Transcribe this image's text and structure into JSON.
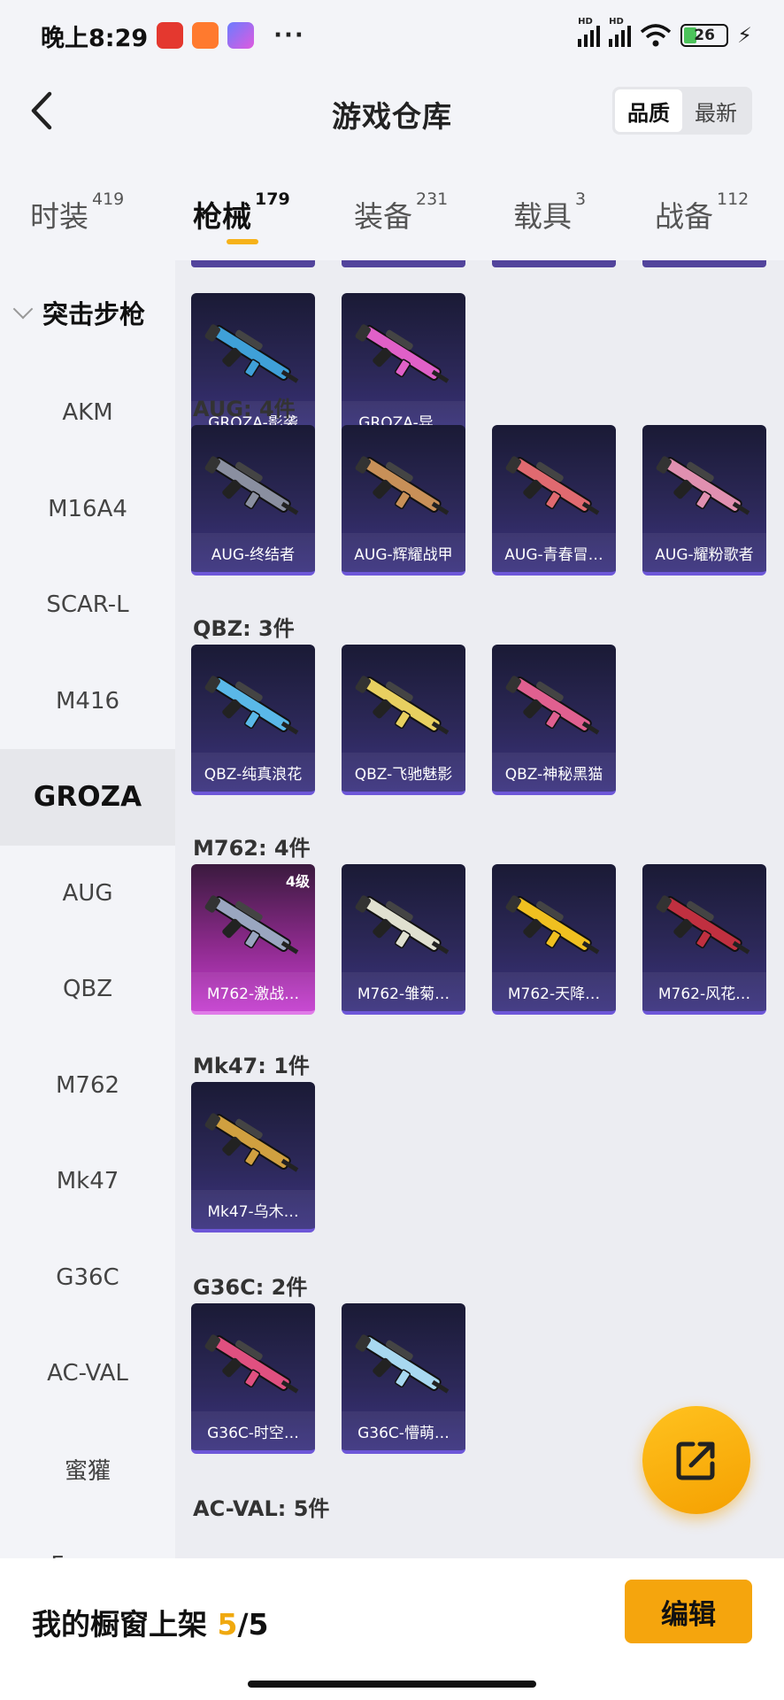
{
  "status_bar": {
    "time": "晚上8:29",
    "battery": "26",
    "more": "···",
    "signal_tag": "HD"
  },
  "header": {
    "title": "游戏仓库",
    "sort_options": [
      "品质",
      "最新"
    ]
  },
  "tabs": [
    {
      "label": "时装",
      "count": "419"
    },
    {
      "label": "枪械",
      "count": "179"
    },
    {
      "label": "装备",
      "count": "231"
    },
    {
      "label": "载具",
      "count": "3"
    },
    {
      "label": "战备",
      "count": "112"
    }
  ],
  "sidebar": {
    "group": "突击步枪",
    "items": [
      "AKM",
      "M16A4",
      "SCAR-L",
      "M416",
      "GROZA",
      "AUG",
      "QBZ",
      "M762",
      "Mk47",
      "G36C",
      "AC-VAL",
      "蜜獾",
      "Famas"
    ],
    "selected": "GROZA"
  },
  "sections": [
    {
      "title": "",
      "items": [
        {
          "name": "GROZA-影袭",
          "color": "#3fa0d8"
        },
        {
          "name": "GROZA-异…",
          "color": "#e060c8"
        }
      ]
    },
    {
      "title": "AUG: 4件",
      "items": [
        {
          "name": "AUG-终结者",
          "color": "#8a8fa0"
        },
        {
          "name": "AUG-辉耀战甲",
          "color": "#c89058"
        },
        {
          "name": "AUG-青春冒…",
          "color": "#e06a70"
        },
        {
          "name": "AUG-耀粉歌者",
          "color": "#e090b0"
        }
      ]
    },
    {
      "title": "QBZ: 3件",
      "items": [
        {
          "name": "QBZ-纯真浪花",
          "color": "#5ab8e8"
        },
        {
          "name": "QBZ-飞驰魅影",
          "color": "#e8d060"
        },
        {
          "name": "QBZ-神秘黑猫",
          "color": "#e06090"
        }
      ]
    },
    {
      "title": "M762: 4件",
      "items": [
        {
          "name": "M762-激战…",
          "color": "#9aa6c0",
          "level": "4级"
        },
        {
          "name": "M762-雏菊…",
          "color": "#e0e0d0"
        },
        {
          "name": "M762-天降…",
          "color": "#f0c020"
        },
        {
          "name": "M762-风花…",
          "color": "#c03040"
        }
      ]
    },
    {
      "title": "Mk47: 1件",
      "items": [
        {
          "name": "Mk47-乌木…",
          "color": "#d0a040"
        }
      ]
    },
    {
      "title": "G36C: 2件",
      "items": [
        {
          "name": "G36C-时空…",
          "color": "#e05080"
        },
        {
          "name": "G36C-懵萌…",
          "color": "#a8d8f0"
        }
      ]
    },
    {
      "title": "AC-VAL: 5件",
      "items": []
    }
  ],
  "bottom": {
    "label": "我的橱窗上架",
    "current": "5",
    "total": "/5",
    "edit_label": "编辑"
  },
  "icons": {
    "back": "back-arrow-icon",
    "fab": "share-external-icon"
  }
}
